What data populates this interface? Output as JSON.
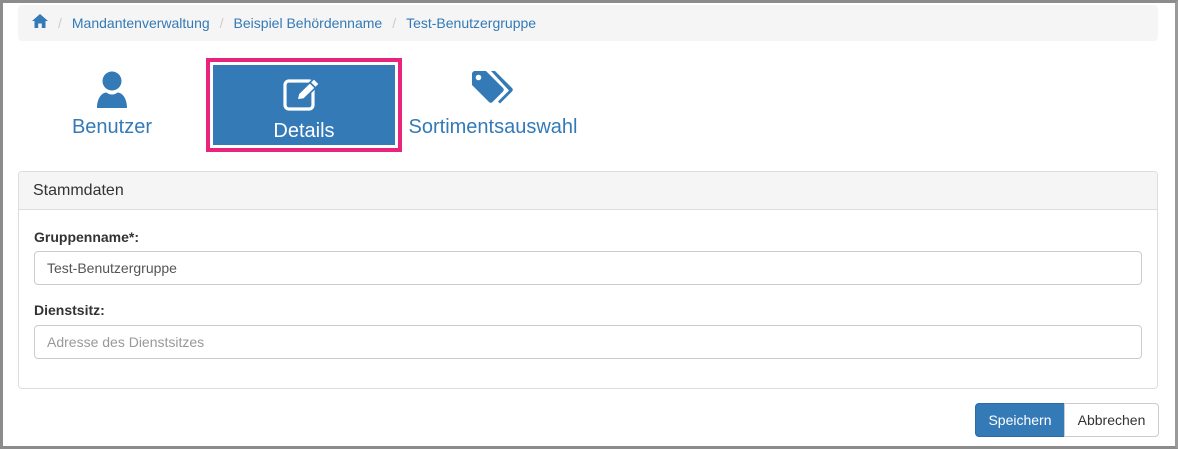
{
  "breadcrumb": {
    "home_icon": "home-icon",
    "items": [
      "Mandantenverwaltung",
      "Beispiel Behördenname",
      "Test-Benutzergruppe"
    ],
    "separator": "/"
  },
  "tabs": [
    {
      "label": "Benutzer",
      "icon": "user-icon",
      "active": false
    },
    {
      "label": "Details",
      "icon": "edit-icon",
      "active": true
    },
    {
      "label": "Sortimentsauswahl",
      "icon": "tags-icon",
      "active": false
    }
  ],
  "panel": {
    "title": "Stammdaten",
    "group_name_label": "Gruppenname*:",
    "group_name_value": "Test-Benutzergruppe",
    "office_label": "Dienstsitz:",
    "office_value": "",
    "office_placeholder": "Adresse des Dienstsitzes"
  },
  "actions": {
    "save_label": "Speichern",
    "cancel_label": "Abbrechen"
  },
  "colors": {
    "primary": "#337ab7",
    "highlight": "#e8257a"
  }
}
